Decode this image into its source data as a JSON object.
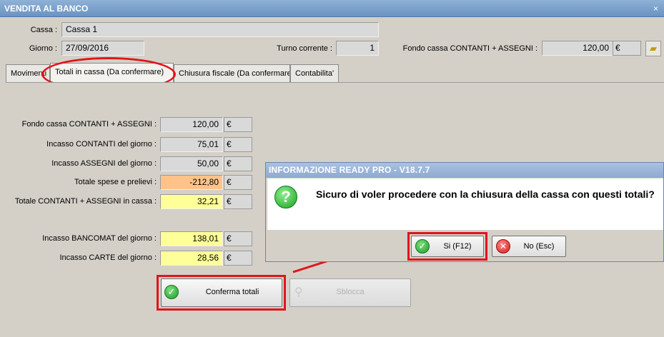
{
  "window": {
    "title": "VENDITA AL BANCO",
    "close": "×"
  },
  "header": {
    "cassa_label": "Cassa :",
    "cassa_value": "Cassa 1",
    "giorno_label": "Giorno :",
    "giorno_value": "27/09/2016",
    "turno_label": "Turno corrente :",
    "turno_value": "1",
    "fondo_label": "Fondo cassa CONTANTI + ASSEGNI :",
    "fondo_value": "120,00",
    "fondo_unit": "€"
  },
  "tabs": [
    {
      "label": "Movimenti"
    },
    {
      "label": "Totali in cassa (Da confermare)"
    },
    {
      "label": "Chiusura fiscale (Da confermare)"
    },
    {
      "label": "Contabilita'"
    }
  ],
  "totals": {
    "rows": [
      {
        "label": "Fondo cassa CONTANTI + ASSEGNI :",
        "value": "120,00",
        "unit": "€"
      },
      {
        "label": "Incasso CONTANTI del giorno :",
        "value": "75,01",
        "unit": "€"
      },
      {
        "label": "Incasso ASSEGNI del giorno :",
        "value": "50,00",
        "unit": "€"
      },
      {
        "label": "Totale spese e prelievi :",
        "value": "-212,80",
        "unit": "€"
      },
      {
        "label": "Totale CONTANTI + ASSEGNI in cassa :",
        "value": "32,21",
        "unit": "€"
      },
      {
        "label": "Incasso BANCOMAT del giorno :",
        "value": "138,01",
        "unit": "€"
      },
      {
        "label": "Incasso CARTE del giorno :",
        "value": "28,56",
        "unit": "€"
      }
    ]
  },
  "buttons": {
    "conferma": "Conferma totali",
    "sblocca": "Sblocca"
  },
  "dialog": {
    "title": "INFORMAZIONE READY PRO - V18.7.7",
    "message": "Sicuro di voler procedere con la chiusura della cassa con questi totali?",
    "yes": "Si (F12)",
    "no": "No (Esc)"
  },
  "colors": {
    "highlight_red": "#e2141c",
    "yellow_field": "#ffff99",
    "orange_field": "#ffc38a"
  }
}
